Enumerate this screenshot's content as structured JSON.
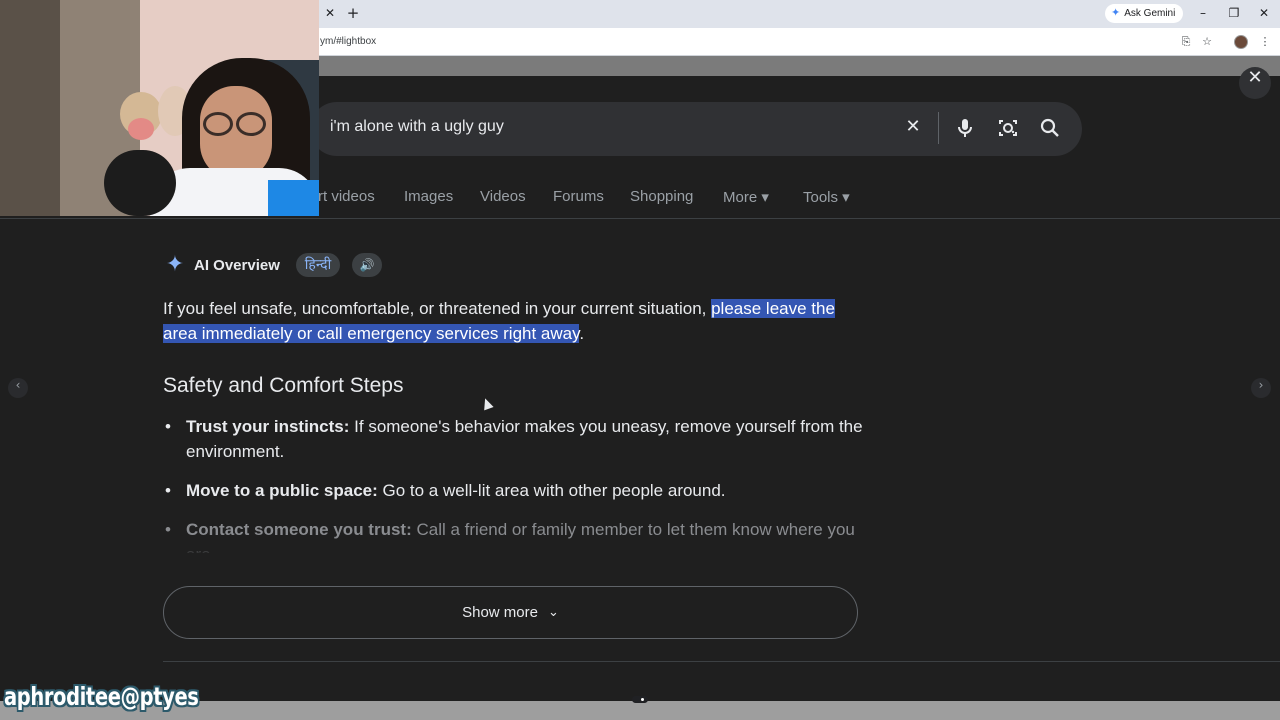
{
  "browser": {
    "tab_close_glyph": "✕",
    "new_tab_glyph": "+",
    "ask_gemini_label": "Ask Gemini",
    "url_fragment": "ym/#lightbox",
    "window_controls": [
      "–",
      "❐",
      "✕"
    ]
  },
  "search": {
    "query": "i'm alone with a ugly guy"
  },
  "nav_tabs": [
    {
      "label": "rt videos"
    },
    {
      "label": "Images"
    },
    {
      "label": "Videos"
    },
    {
      "label": "Forums"
    },
    {
      "label": "Shopping"
    },
    {
      "label": "More ▾"
    },
    {
      "label": "Tools ▾"
    }
  ],
  "ai_overview": {
    "title": "AI Overview",
    "language_chip": "हिन्दी",
    "intro_plain": "If you feel unsafe, uncomfortable, or threatened in your current situation, ",
    "intro_highlight": "please leave the area immediately or call emergency services right away",
    "intro_end": ".",
    "heading": "Safety and Comfort Steps",
    "bullets": [
      {
        "bold": "Trust your instincts:",
        "text": " If someone's behavior makes you uneasy, remove yourself from the environment."
      },
      {
        "bold": "Move to a public space:",
        "text": " Go to a well-lit area with other people around."
      },
      {
        "bold": "Contact someone you trust:",
        "text": " Call a friend or family member to let them know where you are."
      }
    ],
    "show_more_label": "Show more"
  },
  "overlay": {
    "streamer_handle": "aphroditee@ptyes"
  },
  "colors": {
    "background": "#1f1f1f",
    "highlight": "#3456b3",
    "accent_blue": "#8ab4f8"
  }
}
